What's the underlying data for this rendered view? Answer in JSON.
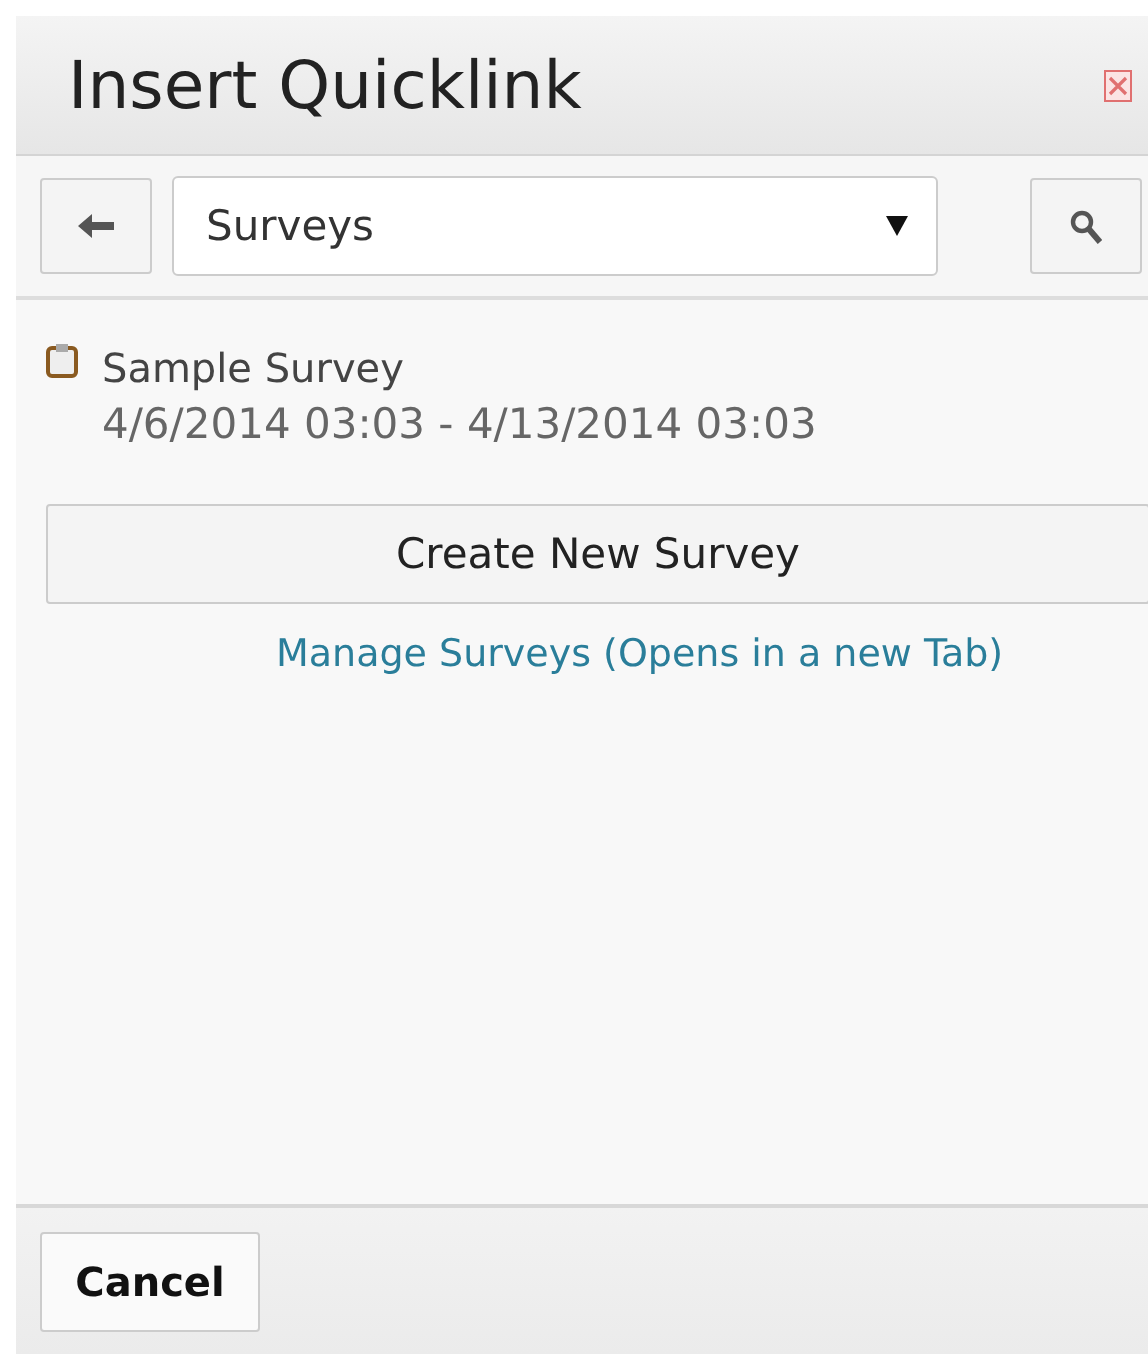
{
  "dialog": {
    "title": "Insert Quicklink"
  },
  "toolbar": {
    "category": "Surveys"
  },
  "items": [
    {
      "name": "Sample Survey",
      "dates": "4/6/2014 03:03 - 4/13/2014 03:03"
    }
  ],
  "create_button": "Create New Survey",
  "manage_link": "Manage Surveys (Opens in a new Tab)",
  "footer": {
    "buttons": [
      "Cancel"
    ]
  }
}
